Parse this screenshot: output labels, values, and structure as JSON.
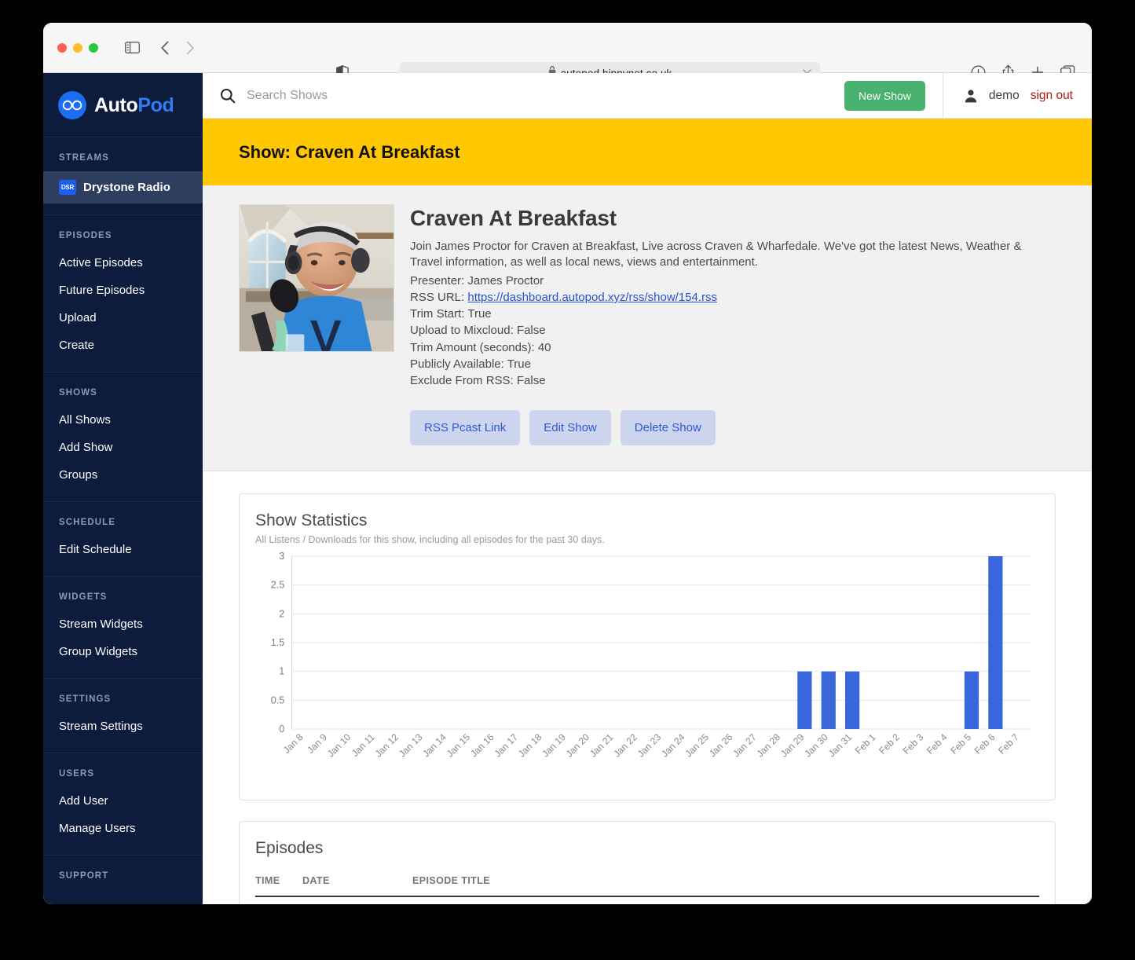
{
  "browser": {
    "url": "autopod.hippynet.co.uk",
    "icons": {
      "sidebar": "sidebar-toggle-icon",
      "back": "back-arrow-icon",
      "forward": "forward-arrow-icon",
      "shield": "privacy-shield-icon",
      "lock": "lock-icon",
      "close": "close-icon",
      "download": "download-icon",
      "share": "share-icon",
      "newtab": "plus-icon",
      "tabs": "tab-overview-icon"
    }
  },
  "sidebar": {
    "brand": {
      "part1": "Auto",
      "part2": "Pod",
      "logo": "glasses-logo-icon"
    },
    "groups": [
      {
        "heading": "STREAMS",
        "items": [
          {
            "label": "Drystone Radio",
            "badge": "DSR",
            "active": true
          }
        ]
      },
      {
        "heading": "EPISODES",
        "items": [
          {
            "label": "Active Episodes"
          },
          {
            "label": "Future Episodes"
          },
          {
            "label": "Upload"
          },
          {
            "label": "Create"
          }
        ]
      },
      {
        "heading": "SHOWS",
        "items": [
          {
            "label": "All Shows"
          },
          {
            "label": "Add Show"
          },
          {
            "label": "Groups"
          }
        ]
      },
      {
        "heading": "SCHEDULE",
        "items": [
          {
            "label": "Edit Schedule"
          }
        ]
      },
      {
        "heading": "WIDGETS",
        "items": [
          {
            "label": "Stream Widgets"
          },
          {
            "label": "Group Widgets"
          }
        ]
      },
      {
        "heading": "SETTINGS",
        "items": [
          {
            "label": "Stream Settings"
          }
        ]
      },
      {
        "heading": "USERS",
        "items": [
          {
            "label": "Add User"
          },
          {
            "label": "Manage Users"
          }
        ]
      },
      {
        "heading": "SUPPORT",
        "items": []
      }
    ]
  },
  "appbar": {
    "search_placeholder": "Search Shows",
    "search_value": "",
    "new_show_label": "New Show",
    "user_name": "demo",
    "sign_out_label": "sign out"
  },
  "banner": {
    "title": "Show: Craven At Breakfast"
  },
  "show": {
    "title": "Craven At Breakfast",
    "description": "Join James Proctor for Craven at Breakfast, Live across Craven & Wharfedale. We've got the latest News, Weather & Travel information, as well as local news, views and entertainment.",
    "meta": [
      {
        "label": "Presenter:",
        "value": "James Proctor"
      },
      {
        "label": "Trim Start:",
        "value": "True"
      },
      {
        "label": "Upload to Mixcloud:",
        "value": "False"
      },
      {
        "label": "Trim Amount (seconds):",
        "value": "40"
      },
      {
        "label": "Publicly Available:",
        "value": "True"
      },
      {
        "label": "Exclude From RSS:",
        "value": "False"
      }
    ],
    "rss_label": "RSS URL:",
    "rss_url": "https://dashboard.autopod.xyz/rss/show/154.rss",
    "buttons": [
      {
        "label": "RSS Pcast Link"
      },
      {
        "label": "Edit Show"
      },
      {
        "label": "Delete Show"
      }
    ]
  },
  "statistics": {
    "title": "Show Statistics",
    "subtitle": "All Listens / Downloads for this show, including all episodes for the past 30 days."
  },
  "chart_data": {
    "type": "bar",
    "title": "Show Statistics",
    "subtitle": "All Listens / Downloads for this show, including all episodes for the past 30 days.",
    "xlabel": "",
    "ylabel": "",
    "ylim": [
      0,
      3
    ],
    "yticks": [
      0,
      0.5,
      1,
      1.5,
      2,
      2.5,
      3
    ],
    "ytick_labels": [
      "0",
      "0.5",
      "1",
      "1.5",
      "2",
      "2.5",
      "3"
    ],
    "grid": true,
    "legend": false,
    "bar_color": "#3a66dc",
    "categories": [
      "Jan 8",
      "Jan 9",
      "Jan 10",
      "Jan 11",
      "Jan 12",
      "Jan 13",
      "Jan 14",
      "Jan 15",
      "Jan 16",
      "Jan 17",
      "Jan 18",
      "Jan 19",
      "Jan 20",
      "Jan 21",
      "Jan 22",
      "Jan 23",
      "Jan 24",
      "Jan 25",
      "Jan 26",
      "Jan 27",
      "Jan 28",
      "Jan 29",
      "Jan 30",
      "Jan 31",
      "Feb 1",
      "Feb 2",
      "Feb 3",
      "Feb 4",
      "Feb 5",
      "Feb 6",
      "Feb 7"
    ],
    "values": [
      0,
      0,
      0,
      0,
      0,
      0,
      0,
      0,
      0,
      0,
      0,
      0,
      0,
      0,
      0,
      0,
      0,
      0,
      0,
      0,
      0,
      1,
      1,
      1,
      0,
      0,
      0,
      0,
      1,
      3,
      0
    ]
  },
  "episodes": {
    "title": "Episodes",
    "columns": [
      "TIME",
      "DATE",
      "EPISODE TITLE"
    ],
    "rows": []
  }
}
